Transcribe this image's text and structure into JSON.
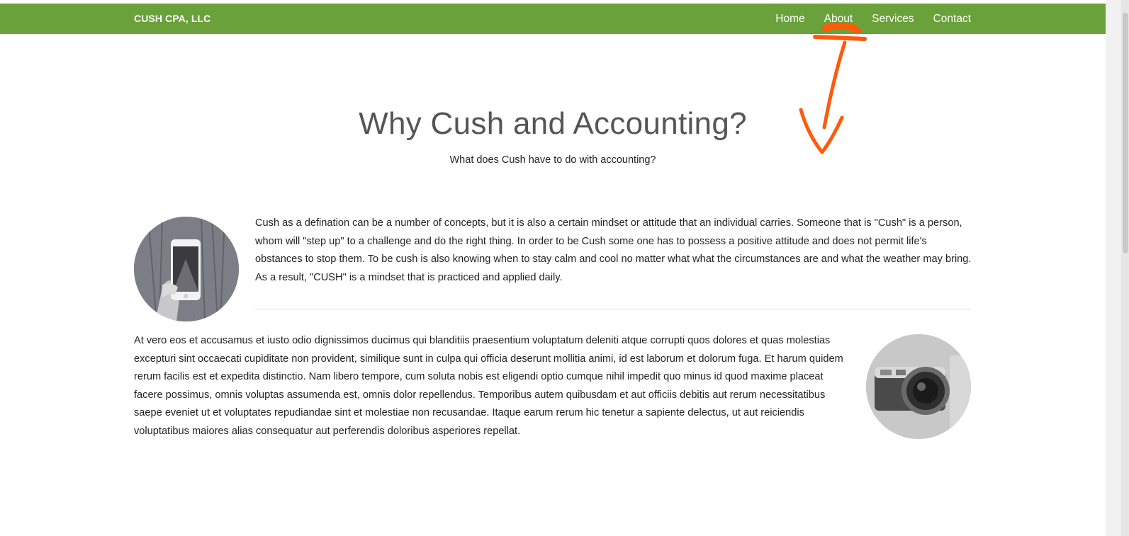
{
  "navbar": {
    "brand": "CUSH CPA, LLC",
    "links": [
      "Home",
      "About",
      "Services",
      "Contact"
    ],
    "background_color": "#6aa13a"
  },
  "header": {
    "title": "Why Cush and Accounting?",
    "subtitle": "What does Cush have to do with accounting?"
  },
  "sections": [
    {
      "image_icon": "phone-photo",
      "text": "Cush as a defination can be a number of concepts, but it is also a certain mindset or attitude that an individual carries. Someone that is \"Cush\" is a person, whom will \"step up\" to a challenge and do the right thing. In order to be Cush some one has to possess a positive attitude and does not permit life's obstances to stop them. To be cush is also knowing when to stay calm and cool no matter what what the circumstances are and what the weather may bring. As a result, \"CUSH\" is a mindset that is practiced and applied daily."
    },
    {
      "image_icon": "camera-photo",
      "text": "At vero eos et accusamus et iusto odio dignissimos ducimus qui blanditiis praesentium voluptatum deleniti atque corrupti quos dolores et quas molestias excepturi sint occaecati cupiditate non provident, similique sunt in culpa qui officia deserunt mollitia animi, id est laborum et dolorum fuga. Et harum quidem rerum facilis est et expedita distinctio. Nam libero tempore, cum soluta nobis est eligendi optio cumque nihil impedit quo minus id quod maxime placeat facere possimus, omnis voluptas assumenda est, omnis dolor repellendus. Temporibus autem quibusdam et aut officiis debitis aut rerum necessitatibus saepe eveniet ut et voluptates repudiandae sint et molestiae non recusandae. Itaque earum rerum hic tenetur a sapiente delectus, ut aut reiciendis voluptatibus maiores alias consequatur aut perferendis doloribus asperiores repellat."
    }
  ],
  "annotation": {
    "color": "#ff5a0a",
    "icon": "arrow-down-annotation"
  }
}
